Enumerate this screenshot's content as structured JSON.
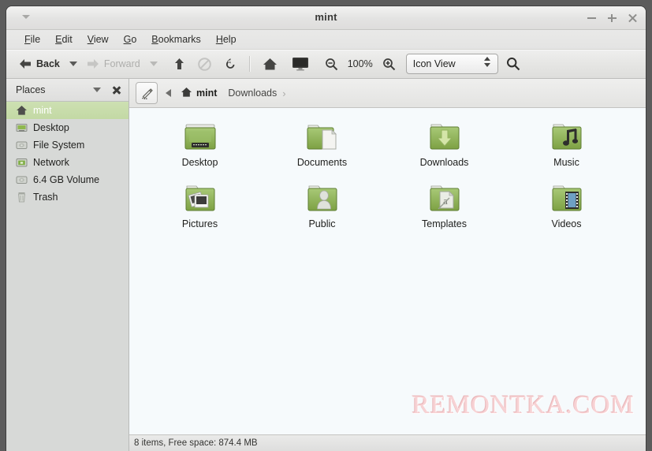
{
  "window": {
    "title": "mint",
    "controls": {
      "minimize": "−",
      "maximize": "+",
      "close": "×"
    }
  },
  "menubar": {
    "items": [
      {
        "label": "File",
        "accel": "F",
        "rest": "ile"
      },
      {
        "label": "Edit",
        "accel": "E",
        "rest": "dit"
      },
      {
        "label": "View",
        "accel": "V",
        "rest": "iew"
      },
      {
        "label": "Go",
        "accel": "G",
        "rest": "o"
      },
      {
        "label": "Bookmarks",
        "accel": "B",
        "rest": "ookmarks"
      },
      {
        "label": "Help",
        "accel": "H",
        "rest": "elp"
      }
    ]
  },
  "toolbar": {
    "back_label": "Back",
    "forward_label": "Forward",
    "zoom_level": "100%",
    "view_mode": "Icon View",
    "icons": {
      "back": "back-arrow-icon",
      "forward": "forward-arrow-icon",
      "up": "up-arrow-icon",
      "stop": "stop-icon",
      "reload": "reload-icon",
      "home": "home-icon",
      "computer": "computer-icon",
      "zoom_out": "zoom-out-icon",
      "zoom_in": "zoom-in-icon",
      "search": "search-icon"
    }
  },
  "sidebar": {
    "header": "Places",
    "items": [
      {
        "label": "mint",
        "icon": "home-icon",
        "selected": true
      },
      {
        "label": "Desktop",
        "icon": "desktop-icon",
        "selected": false
      },
      {
        "label": "File System",
        "icon": "drive-icon",
        "selected": false
      },
      {
        "label": "Network",
        "icon": "network-icon",
        "selected": false
      },
      {
        "label": "6.4 GB Volume",
        "icon": "drive-icon",
        "selected": false
      },
      {
        "label": "Trash",
        "icon": "trash-icon",
        "selected": false
      }
    ]
  },
  "pathbar": {
    "crumbs": [
      {
        "label": "mint",
        "current": true
      },
      {
        "label": "Downloads",
        "current": false
      }
    ]
  },
  "files": [
    {
      "name": "Desktop",
      "icon": "folder-desktop-icon"
    },
    {
      "name": "Documents",
      "icon": "folder-documents-icon"
    },
    {
      "name": "Downloads",
      "icon": "folder-downloads-icon"
    },
    {
      "name": "Music",
      "icon": "folder-music-icon"
    },
    {
      "name": "Pictures",
      "icon": "folder-pictures-icon"
    },
    {
      "name": "Public",
      "icon": "folder-public-icon"
    },
    {
      "name": "Templates",
      "icon": "folder-templates-icon"
    },
    {
      "name": "Videos",
      "icon": "folder-videos-icon"
    }
  ],
  "statusbar": {
    "text": "8 items, Free space: 874.4 MB"
  },
  "watermark": {
    "text": "REMONTKA.COM"
  },
  "colors": {
    "desktop": "#5c5c5c",
    "selection": "#c6dba7",
    "folder_green": "#8cb24f",
    "content_bg": "#f6fafc",
    "watermark": "#f7d2d4"
  }
}
